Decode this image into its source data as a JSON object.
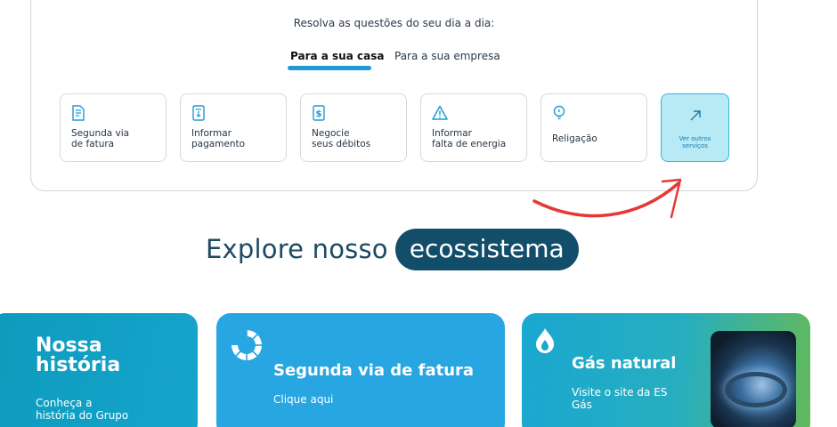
{
  "panel": {
    "prompt": "Resolva as questões do seu dia a dia:",
    "tabs": [
      {
        "label": "Para a sua casa",
        "active": true
      },
      {
        "label": "Para a sua empresa",
        "active": false
      }
    ],
    "tiles": [
      {
        "label": "Segunda via\nde fatura",
        "icon": "invoice-icon"
      },
      {
        "label": "Informar\npagamento",
        "icon": "receipt-icon"
      },
      {
        "label": "Negocie\nseus débitos",
        "icon": "dollar-document-icon"
      },
      {
        "label": "Informar\nfalta de energia",
        "icon": "warning-icon"
      },
      {
        "label": "Religação",
        "icon": "lightbulb-icon"
      },
      {
        "label": "Ver outros\nserviços",
        "icon": "arrow-up-right-icon"
      }
    ]
  },
  "explore": {
    "text": "Explore nosso",
    "pill": "ecossistema"
  },
  "cards": [
    {
      "title": "Nossa\nhistória",
      "subtitle": "Conheça a\nhistória do Grupo"
    },
    {
      "title": "Segunda via de fatura",
      "subtitle": "Clique aqui",
      "icon": "brand-logo-icon"
    },
    {
      "title": "Gás natural",
      "subtitle": "Visite o site da ES\nGás",
      "icon": "flame-icon"
    }
  ],
  "colors": {
    "accent": "#1f9ad6",
    "pill_bg": "#124e6a",
    "highlight_tile": "#b8eaf6",
    "annotation_arrow": "#e53935"
  }
}
